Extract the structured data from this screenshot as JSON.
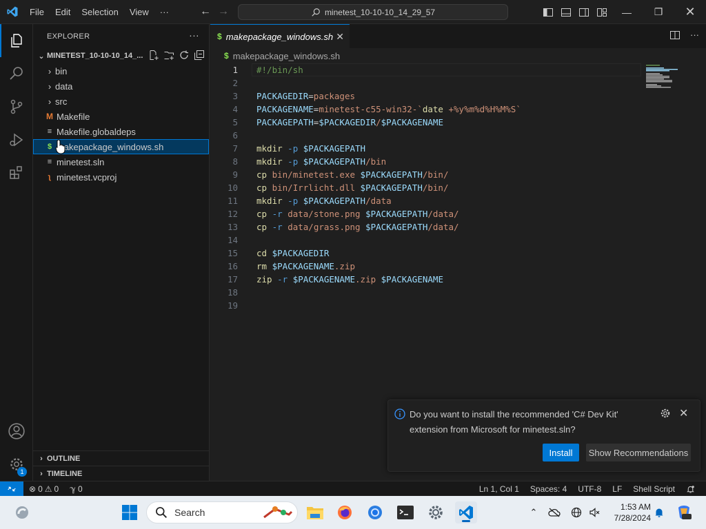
{
  "titlebar": {
    "menu": [
      "File",
      "Edit",
      "Selection",
      "View"
    ],
    "more": "···",
    "command_center": "minetest_10-10-10_14_29_57"
  },
  "sidebar": {
    "header": "EXPLORER",
    "more": "···",
    "folder": "MINETEST_10-10-10_14_...",
    "items": [
      {
        "label": "bin",
        "kind": "folder"
      },
      {
        "label": "data",
        "kind": "folder"
      },
      {
        "label": "src",
        "kind": "folder"
      },
      {
        "label": "Makefile",
        "kind": "makefile"
      },
      {
        "label": "Makefile.globaldeps",
        "kind": "text"
      },
      {
        "label": "makepackage_windows.sh",
        "kind": "shell",
        "selected": true
      },
      {
        "label": "minetest.sln",
        "kind": "text"
      },
      {
        "label": "minetest.vcproj",
        "kind": "rss"
      }
    ],
    "outline": "OUTLINE",
    "timeline": "TIMELINE"
  },
  "activity": {
    "badge": "1"
  },
  "editor": {
    "tab_label": "makepackage_windows.sh",
    "breadcrumb": "makepackage_windows.sh",
    "active_line": 1,
    "lines": [
      "#!/bin/sh",
      "",
      "PACKAGEDIR=packages",
      "PACKAGENAME=minetest-c55-win32-`date +%y%m%d%H%M%S`",
      "PACKAGEPATH=$PACKAGEDIR/$PACKAGENAME",
      "",
      "mkdir -p $PACKAGEPATH",
      "mkdir -p $PACKAGEPATH/bin",
      "cp bin/minetest.exe $PACKAGEPATH/bin/",
      "cp bin/Irrlicht.dll $PACKAGEPATH/bin/",
      "mkdir -p $PACKAGEPATH/data",
      "cp -r data/stone.png $PACKAGEPATH/data/",
      "cp -r data/grass.png $PACKAGEPATH/data/",
      "",
      "cd $PACKAGEDIR",
      "rm $PACKAGENAME.zip",
      "zip -r $PACKAGENAME.zip $PACKAGENAME",
      "",
      ""
    ]
  },
  "notification": {
    "text_line1": "Do you want to install the recommended 'C# Dev Kit'",
    "text_line2": "extension from Microsoft for minetest.sln?",
    "install": "Install",
    "show_recs": "Show Recommendations"
  },
  "statusbar": {
    "errors": "0",
    "warnings": "0",
    "ports": "0",
    "position": "Ln 1, Col 1",
    "spaces": "Spaces: 4",
    "encoding": "UTF-8",
    "eol": "LF",
    "language": "Shell Script"
  },
  "taskbar": {
    "search": "Search",
    "time": "1:53 AM",
    "date": "7/28/2024"
  },
  "colors": {
    "accent": "#0078d4",
    "selection": "#04395e"
  }
}
